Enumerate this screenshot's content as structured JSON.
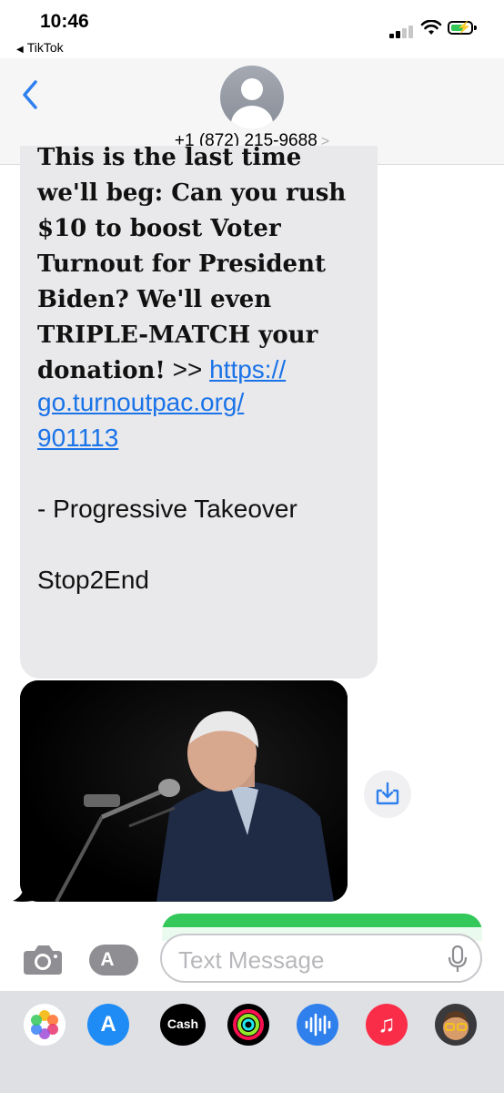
{
  "status_bar": {
    "time": "10:46",
    "back_app": "TikTok"
  },
  "header": {
    "contact_number": "+1 (872) 215-9688"
  },
  "message": {
    "cut_line": "This is the last time",
    "serif_lines": [
      "we'll beg: Can you rush",
      "$10 to boost Voter",
      "Turnout for President",
      "Biden? We'll even",
      "TRIPLE-MATCH your",
      "donation!"
    ],
    "link_prefix": " >> ",
    "link_lines": [
      "https://",
      "go.turnoutpac.org/",
      "901113"
    ],
    "signature": "- Progressive Takeover",
    "stop_text": "Stop2End"
  },
  "composer": {
    "placeholder": "Text Message"
  },
  "app_tray": {
    "cash_label": "Cash"
  },
  "colors": {
    "bubble_gray": "#e9e9eb",
    "link_blue": "#1a73e8",
    "imessage_green": "#34c759",
    "ios_blue": "#2f80ed"
  }
}
